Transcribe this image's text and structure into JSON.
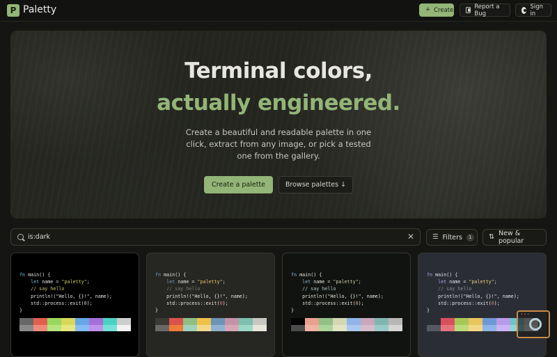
{
  "app": {
    "logo_letter": "P",
    "name": "Paletty"
  },
  "topbar": {
    "create_icon": "+",
    "create_label": "Create",
    "report_label": "Report a Bug",
    "signin_label": "Sign in"
  },
  "hero": {
    "title_line1": "Terminal colors,",
    "title_line2": "actually engineered.",
    "subtitle": "Create a beautiful and readable palette in one click, extract from any image, or pick a tested one from the gallery.",
    "primary_button": "Create a palette",
    "secondary_button": "Browse palettes ↓"
  },
  "search": {
    "value": "is:dark",
    "clear_icon": "✕"
  },
  "filters": {
    "label": "Filters",
    "count": "1",
    "icon": "☰"
  },
  "sort": {
    "label": "New & popular",
    "icon": "⇅"
  },
  "code_lines": [
    {
      "parts": [
        {
          "t": "fn ",
          "c": "kw"
        },
        {
          "t": "main() {",
          "c": "fg"
        }
      ]
    },
    {
      "parts": [
        {
          "t": "    let ",
          "c": "kw"
        },
        {
          "t": "name = ",
          "c": "fg"
        },
        {
          "t": "\"paletty\"",
          "c": "str"
        },
        {
          "t": ";",
          "c": "fg"
        }
      ]
    },
    {
      "parts": [
        {
          "t": "    // say hello",
          "c": "cmt"
        }
      ]
    },
    {
      "parts": [
        {
          "t": "    println!(\"Hello, {}!\", name);",
          "c": "fg"
        }
      ]
    },
    {
      "parts": [
        {
          "t": "    std::process::exit(",
          "c": "fg"
        },
        {
          "t": "0",
          "c": "num"
        },
        {
          "t": ");",
          "c": "fg"
        }
      ]
    },
    {
      "parts": [
        {
          "t": "}",
          "c": "fg"
        }
      ]
    }
  ],
  "cards": [
    {
      "bg": "#000000",
      "colors": {
        "kw": "#6cc0de",
        "fg": "#e6e6e6",
        "str": "#cfd35c",
        "cmt": "#c9c97b",
        "num": "#d0d0d0"
      },
      "swatches": [
        "#676767",
        "#e25f4c",
        "#99d85e",
        "#d9d75b",
        "#64a6e6",
        "#a470d9",
        "#4ad3c4",
        "#cdcdcd",
        "#8a8a8a",
        "#f08a7d",
        "#b5e67d",
        "#e8e77f",
        "#86bcf2",
        "#bf92ec",
        "#77e3d8",
        "#f2f2f2"
      ]
    },
    {
      "bg": "#262623",
      "colors": {
        "kw": "#7f9dba",
        "fg": "#e7e6df",
        "str": "#e9c765",
        "cmt": "#7e7e77",
        "num": "#e17c78"
      },
      "swatches": [
        "#3b3a37",
        "#d9534a",
        "#8ebf85",
        "#f0c14a",
        "#6d93b7",
        "#c493a5",
        "#7fbfae",
        "#c8c6c0",
        "#6a6965",
        "#f07b3a",
        "#9fd3bb",
        "#f4d88a",
        "#8fb2d1",
        "#d7a7b8",
        "#9bd8c6",
        "#e8e5dc"
      ]
    },
    {
      "bg": "#111310",
      "colors": {
        "kw": "#86b6e2",
        "fg": "#e5e7e1",
        "str": "#cfd0a7",
        "cmt": "#b8c8cf",
        "num": "#e7a392"
      },
      "swatches": [
        "#050505",
        "#e9a08f",
        "#94bf86",
        "#d3d7b2",
        "#90b4e8",
        "#c7a7b9",
        "#7fb7b0",
        "#b7b7b5",
        "#4b4b4b",
        "#f0b3a4",
        "#a8d69b",
        "#e2e4c3",
        "#aac7f0",
        "#d6bccb",
        "#98cbc5",
        "#d5d5d3"
      ]
    },
    {
      "bg": "#2b2d34",
      "colors": {
        "kw": "#b1a5e6",
        "fg": "#e6e6ea",
        "str": "#e3d37f",
        "cmt": "#8a8c96",
        "num": "#e57e7e"
      },
      "swatches": [
        "#2b2d34",
        "#d9505c",
        "#a6c858",
        "#e7c55f",
        "#6f99d6",
        "#b89be8",
        "#6ec3c8",
        "#d2d2d6",
        "#565963",
        "#e8737d",
        "#bddb78",
        "#f2d884",
        "#8fb4e9",
        "#ccb4f2",
        "#8ed6da",
        "#ebebee"
      ]
    }
  ]
}
